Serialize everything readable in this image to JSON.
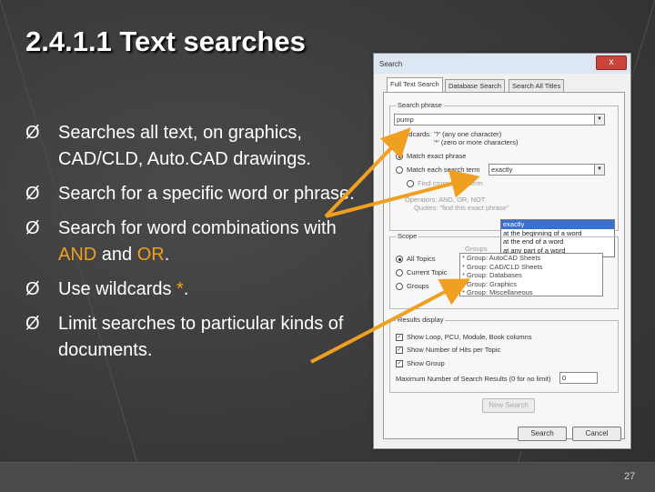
{
  "slide": {
    "title": "2.4.1.1  Text searches",
    "bullet_marker": "Ø",
    "bullets": [
      {
        "text": "Searches all text, on graphics, CAD/CLD, Auto.CAD drawings."
      },
      {
        "text": "Search for a specific word or phrase."
      },
      {
        "pre": "Search for word combinations with ",
        "and": "AND",
        "mid": " and ",
        "or": "OR",
        "post": "."
      },
      {
        "pre": "Use wildcards ",
        "star": "*",
        "post": "."
      },
      {
        "text": "Limit searches to particular kinds of documents."
      }
    ],
    "page_number": "27",
    "highlight_color": "#f0a020",
    "arrow_color": "#f0a020"
  },
  "dialog": {
    "title": "Search",
    "close_glyph": "x",
    "tabs": [
      "Full Text Search",
      "Database Search",
      "Search All Titles"
    ],
    "search_phrase": {
      "group_label": "Search phrase",
      "value": "pump",
      "wildcards_label": "Wildcards:",
      "wildcard_1": "'?' (any one character)",
      "wildcard_2": "'*' (zero or more characters)",
      "opt_exact": "Match exact phrase",
      "opt_each": "Match each search term",
      "opt_find": "Find crossection term",
      "match_value": "exactly",
      "match_options": [
        "exactly",
        "at the beginning of a word",
        "at the end of a word",
        "at any part of a word"
      ],
      "operators": "Operators: AND, OR, NOT",
      "quotes": "Quotes: \"find this exact phrase\""
    },
    "scope": {
      "group_label": "Scope",
      "opt_all": "All Topics",
      "opt_current": "Current Topic",
      "opt_groups": "Groups",
      "groups_header": "Groups",
      "groups": [
        "* Group: AutoCAD Sheets",
        "* Group: CAD/CLD Sheets",
        "* Group: Databases",
        "* Group: Graphics",
        "* Group: Miscellaneous"
      ]
    },
    "results_display": {
      "group_label": "Results display",
      "opt_loop": "Show Loop, PCU, Module, Book columns",
      "opt_hits": "Show Number of Hits per Topic",
      "opt_group": "Show Group",
      "max_label": "Maximum Number of Search Results (0 for no limit)",
      "max_value": "0"
    },
    "buttons": {
      "new_search": "New Search",
      "search": "Search",
      "cancel": "Cancel"
    }
  }
}
